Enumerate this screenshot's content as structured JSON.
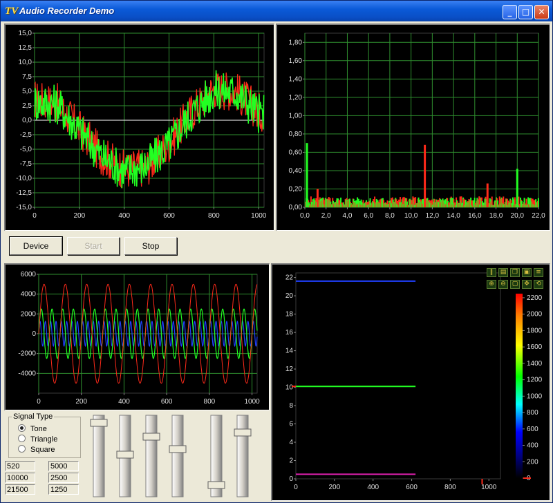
{
  "window": {
    "title": "Audio Recorder Demo",
    "app_icon": "TV",
    "icons": [
      "app-icon",
      "minimize-icon",
      "maximize-icon",
      "close-icon"
    ]
  },
  "buttons": {
    "device": "Device",
    "start": "Start",
    "stop": "Stop"
  },
  "signal_type": {
    "title": "Signal Type",
    "options": [
      {
        "label": "Tone",
        "selected": true
      },
      {
        "label": "Triangle",
        "selected": false
      },
      {
        "label": "Square",
        "selected": false
      }
    ]
  },
  "fields": [
    "520",
    "5000",
    "10000",
    "2500",
    "21500",
    "1250"
  ],
  "colors": {
    "plot_bg": "#000000",
    "grid": "#2f8f2f",
    "green": "#22ff22",
    "red": "#ff2a1a",
    "blue": "#2040ff"
  },
  "chart_data": [
    {
      "type": "line",
      "name": "waveform",
      "x_ticks": [
        "0",
        "200",
        "400",
        "600",
        "800",
        "1000"
      ],
      "y_ticks": [
        "15,0",
        "12,5",
        "10,0",
        "7,5",
        "5,0",
        "2,5",
        "0,0",
        "-2,5",
        "-5,0",
        "-7,5",
        "-10,0",
        "-12,5",
        "-15,0"
      ],
      "xlim": [
        0,
        1024
      ],
      "ylim": [
        -15,
        15
      ],
      "series": [
        {
          "color": "#ff2a1a",
          "x": [
            0,
            100,
            200,
            300,
            400,
            500,
            600,
            700,
            800,
            900,
            1000
          ],
          "values": [
            3.5,
            3.0,
            -1.5,
            -6.0,
            -8.5,
            -8.0,
            -4.0,
            1.5,
            5.5,
            5.0,
            1.5
          ]
        },
        {
          "color": "#22ff22",
          "x": [
            0,
            100,
            200,
            300,
            400,
            500,
            600,
            700,
            800,
            900,
            1000
          ],
          "values": [
            3.2,
            2.8,
            -1.8,
            -6.2,
            -8.8,
            -7.8,
            -4.2,
            1.2,
            5.2,
            4.8,
            1.2
          ]
        }
      ],
      "grid": true
    },
    {
      "type": "bar",
      "name": "spectrum",
      "x_ticks": [
        "0,0",
        "2,0",
        "4,0",
        "6,0",
        "8,0",
        "10,0",
        "12,0",
        "14,0",
        "16,0",
        "18,0",
        "20,0",
        "22,0"
      ],
      "y_ticks": [
        "1,80",
        "1,60",
        "1,40",
        "1,20",
        "1,00",
        "0,80",
        "0,60",
        "0,40",
        "0,20",
        "0,00"
      ],
      "xlim": [
        0,
        22
      ],
      "ylim": [
        0,
        1.9
      ],
      "peaks": [
        {
          "x": 0.2,
          "value": 0.7,
          "color": "#22ff22"
        },
        {
          "x": 11.3,
          "value": 0.68,
          "color": "#ff2a1a"
        },
        {
          "x": 20.0,
          "value": 0.42,
          "color": "#22ff22"
        },
        {
          "x": 17.2,
          "value": 0.26,
          "color": "#ff2a1a"
        },
        {
          "x": 1.2,
          "value": 0.2,
          "color": "#ff2a1a"
        }
      ],
      "grid": true
    },
    {
      "type": "line",
      "name": "signal",
      "x_ticks": [
        "0",
        "200",
        "400",
        "600",
        "800",
        "1000"
      ],
      "y_ticks": [
        "6000",
        "4000",
        "2000",
        "0",
        "-2000",
        "-4000"
      ],
      "xlim": [
        0,
        1024
      ],
      "ylim": [
        -6000,
        6000
      ],
      "series": [
        {
          "color": "#ff2a1a",
          "amplitude": 5000,
          "period": 100
        },
        {
          "color": "#22ff22",
          "amplitude": 2500,
          "period": 50
        },
        {
          "color": "#2040ff",
          "amplitude": 1250,
          "period": 25
        }
      ],
      "grid": true
    },
    {
      "type": "line",
      "name": "spectrogram",
      "x_ticks": [
        "0",
        "200",
        "400",
        "600",
        "800",
        "1000"
      ],
      "y_ticks": [
        "22",
        "20",
        "18",
        "16",
        "14",
        "12",
        "10",
        "8",
        "6",
        "4",
        "2",
        "0"
      ],
      "xlim": [
        0,
        1060
      ],
      "ylim": [
        0,
        22.5
      ],
      "colorbar_ticks": [
        "2200",
        "2000",
        "1800",
        "1600",
        "1400",
        "1200",
        "1000",
        "800",
        "600",
        "400",
        "200",
        "0"
      ],
      "series": [
        {
          "color": "#2040ff",
          "x": [
            0,
            620
          ],
          "values": [
            21.6,
            21.6
          ]
        },
        {
          "color": "#22ff22",
          "x": [
            0,
            620
          ],
          "values": [
            10.1,
            10.1
          ]
        },
        {
          "color": "#e020b0",
          "x": [
            0,
            620
          ],
          "values": [
            0.5,
            0.5
          ]
        }
      ],
      "grid": false
    }
  ]
}
